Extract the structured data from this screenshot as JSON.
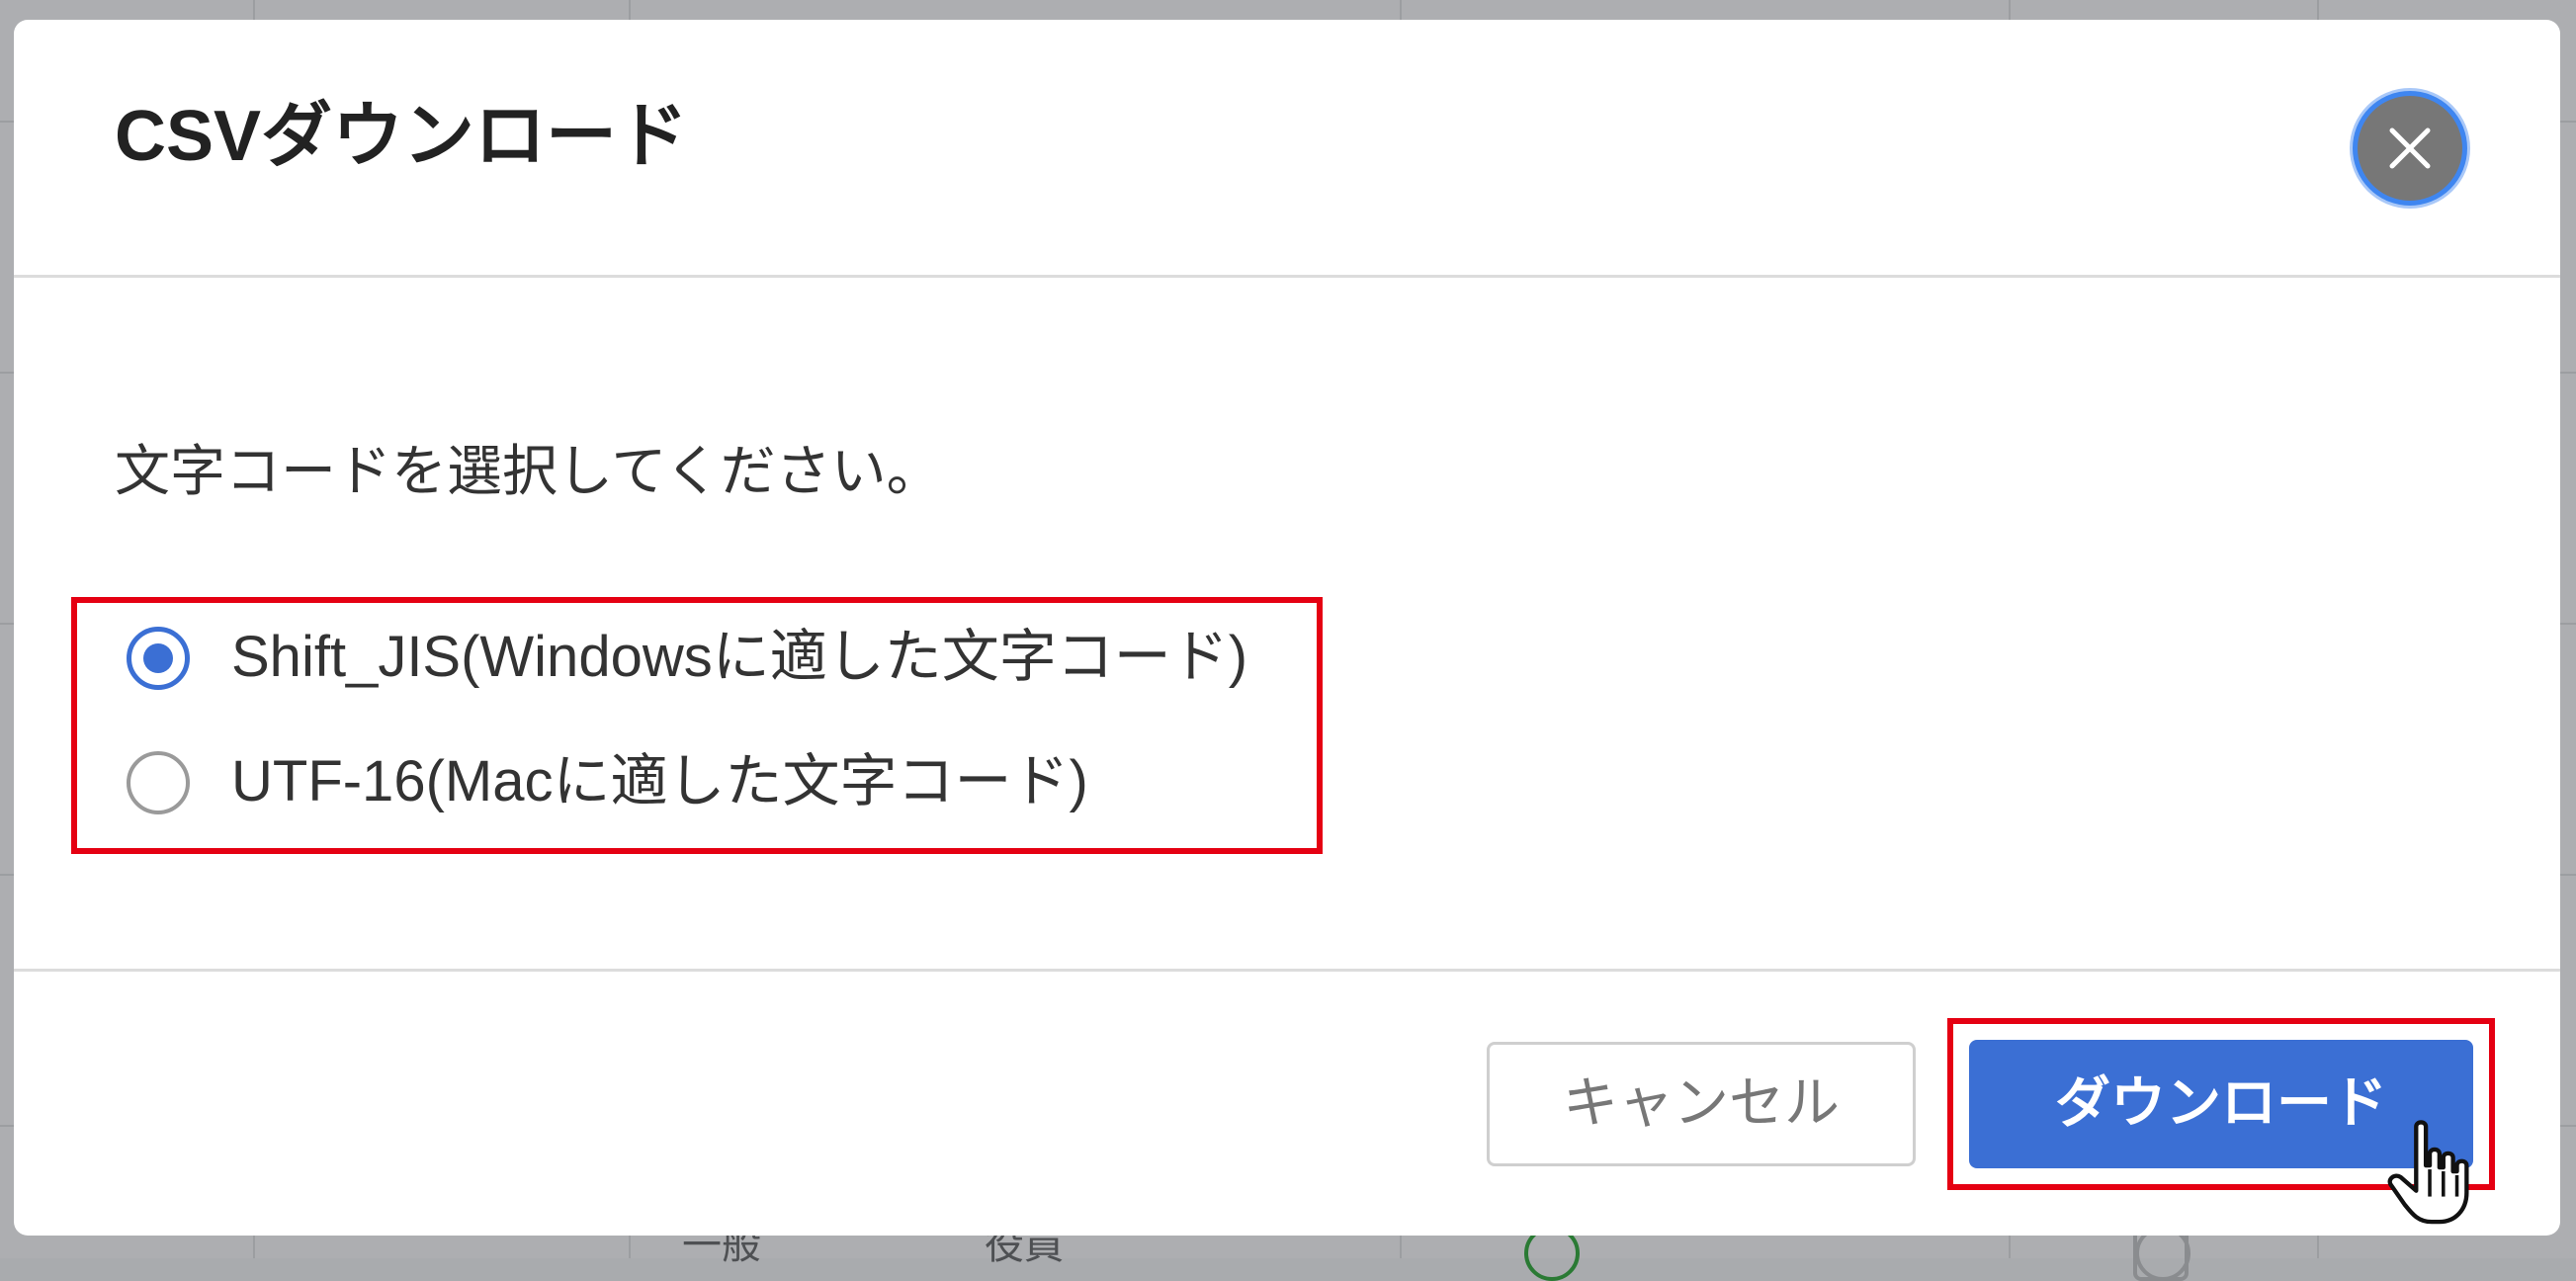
{
  "background": {
    "row_text_1": "一般",
    "row_text_2": "役員"
  },
  "dialog": {
    "title": "CSVダウンロード",
    "close_label": "×",
    "instruction": "文字コードを選択してください。",
    "options": [
      {
        "label": "Shift_JIS(Windowsに適した文字コード)",
        "checked": true
      },
      {
        "label": "UTF-16(Macに適した文字コード)",
        "checked": false
      }
    ],
    "cancel_label": "キャンセル",
    "download_label": "ダウンロード"
  },
  "colors": {
    "primary": "#3b6fd4",
    "highlight": "#e50012",
    "overlay": "#adaeb1",
    "close_button": "#777777",
    "close_focus_ring": "#3f86f0"
  },
  "icons": {
    "close": "close-icon",
    "cursor": "pointer-hand-icon"
  }
}
